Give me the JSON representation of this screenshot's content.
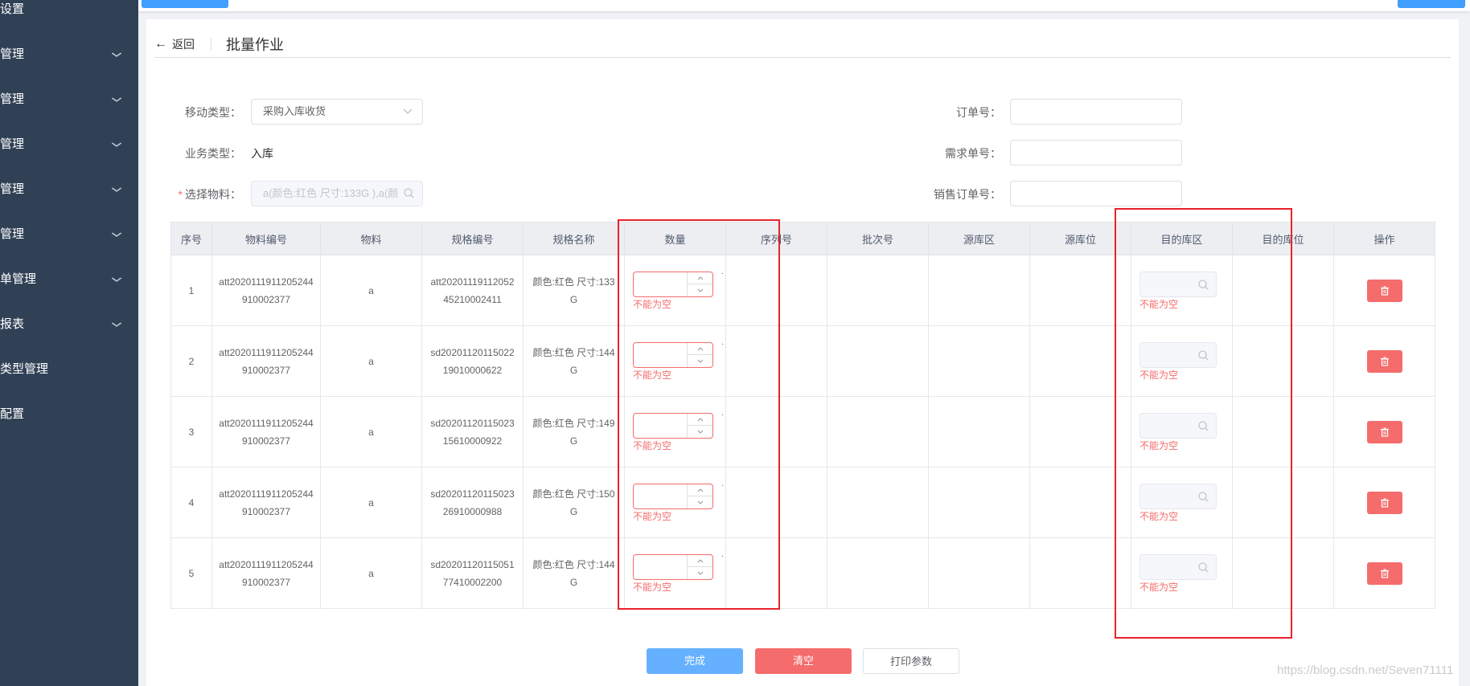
{
  "sidebar": {
    "items": [
      {
        "label": "设置",
        "has_chevron": false
      },
      {
        "label": "管理",
        "has_chevron": true
      },
      {
        "label": "管理",
        "has_chevron": true
      },
      {
        "label": "管理",
        "has_chevron": true
      },
      {
        "label": "管理",
        "has_chevron": true
      },
      {
        "label": "管理",
        "has_chevron": true
      },
      {
        "label": "单管理",
        "has_chevron": true
      },
      {
        "label": "报表",
        "has_chevron": true
      },
      {
        "label": "类型管理",
        "has_chevron": false
      },
      {
        "label": "配置",
        "has_chevron": false
      }
    ]
  },
  "header": {
    "back_label": "返回",
    "title": "批量作业"
  },
  "form": {
    "move_type_label": "移动类型：",
    "move_type_value": "采购入库收货",
    "biz_type_label": "业务类型：",
    "biz_type_value": "入库",
    "material_label": "选择物料：",
    "material_value": "a(颜色:红色 尺寸:133G ),a(颜",
    "order_no_label": "订单号：",
    "demand_no_label": "需求单号：",
    "sales_order_no_label": "销售订单号："
  },
  "table": {
    "headers": [
      "序号",
      "物料编号",
      "物料",
      "规格编号",
      "规格名称",
      "数量",
      "序列号",
      "批次号",
      "源库区",
      "源库位",
      "目的库区",
      "目的库位",
      "操作"
    ],
    "rows": [
      {
        "idx": "1",
        "material_no": "att2020111911205244910002377",
        "material": "a",
        "spec_no": "att2020111911205245210002411",
        "spec_name": "颜色:红色 尺寸:133G"
      },
      {
        "idx": "2",
        "material_no": "att2020111911205244910002377",
        "material": "a",
        "spec_no": "sd2020112011502219010000622",
        "spec_name": "颜色:红色 尺寸:144G"
      },
      {
        "idx": "3",
        "material_no": "att2020111911205244910002377",
        "material": "a",
        "spec_no": "sd2020112011502315610000922",
        "spec_name": "颜色:红色 尺寸:149G"
      },
      {
        "idx": "4",
        "material_no": "att2020111911205244910002377",
        "material": "a",
        "spec_no": "sd2020112011502326910000988",
        "spec_name": "颜色:红色 尺寸:150G"
      },
      {
        "idx": "5",
        "material_no": "att2020111911205244910002377",
        "material": "a",
        "spec_no": "sd2020112011505177410002200",
        "spec_name": "颜色:红色 尺寸:144G"
      }
    ],
    "error_text": "不能为空",
    "dot_text": "."
  },
  "buttons": {
    "complete": "完成",
    "clear": "清空",
    "print_params": "打印参数"
  },
  "watermark": "https://blog.csdn.net/Seven71111",
  "colors": {
    "sidebar_bg": "#304156",
    "primary": "#409eff",
    "danger": "#f56c6c",
    "annotation_red": "#e8222b"
  }
}
